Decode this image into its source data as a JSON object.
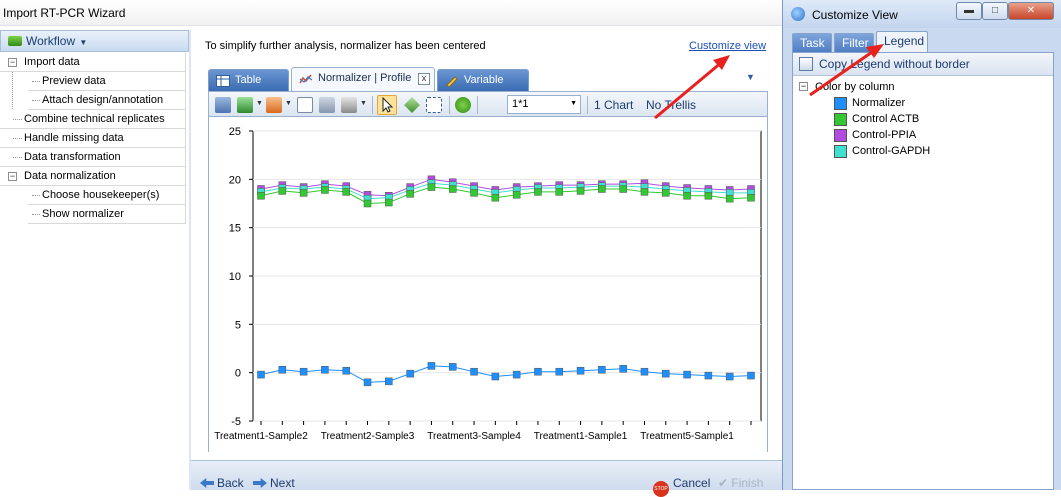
{
  "wizard": {
    "title": "Import RT-PCR Wizard",
    "workflow_label": "Workflow",
    "tree": [
      {
        "label": "Import data",
        "level": 0,
        "expander": "−"
      },
      {
        "label": "Preview data",
        "level": 1
      },
      {
        "label": "Attach design/annotation",
        "level": 1
      },
      {
        "label": "Combine technical replicates",
        "level": 0
      },
      {
        "label": "Handle missing data",
        "level": 0
      },
      {
        "label": "Data transformation",
        "level": 0
      },
      {
        "label": "Data normalization",
        "level": 0,
        "expander": "−"
      },
      {
        "label": "Choose housekeeper(s)",
        "level": 1
      },
      {
        "label": "Show normalizer",
        "level": 1
      }
    ],
    "info_text": "To simplify further analysis, normalizer has been centered",
    "customize_link": "Customize view",
    "tabs": [
      {
        "label": "Table",
        "icon": "table-icon"
      },
      {
        "label": "Normalizer | Profile",
        "icon": "profile-icon",
        "close": "x"
      },
      {
        "label": "Variable",
        "icon": "variable-icon"
      }
    ],
    "toolbar": {
      "zoom_value": "1*1",
      "chart_count": "1 Chart",
      "trellis": "No Trellis"
    },
    "buttons": {
      "back": "Back",
      "next": "Next",
      "cancel": "Cancel",
      "finish": "Finish",
      "stop_icon_text": "STOP"
    }
  },
  "customize_view": {
    "title": "Customize View",
    "win_buttons": {
      "minimize": "▬",
      "maximize": "□",
      "close": "✕"
    },
    "tabs": [
      "Task",
      "Filter",
      "Legend"
    ],
    "active_tab": "Legend",
    "copy_legend": "Copy Legend  without border",
    "legend_root": "Color by column",
    "legend_items": [
      {
        "label": "Normalizer",
        "color": "#1e8fff"
      },
      {
        "label": "Control ACTB",
        "color": "#32c832"
      },
      {
        "label": "Control-PPIA",
        "color": "#b44be1"
      },
      {
        "label": "Control-GAPDH",
        "color": "#40e0d0"
      }
    ]
  },
  "chart_data": {
    "type": "line",
    "ylim": [
      -5,
      25
    ],
    "yticks": [
      25,
      20,
      15,
      10,
      5,
      0,
      -5
    ],
    "x_tick_labels": [
      "Treatment1-Sample2",
      "Treatment2-Sample3",
      "Treatment3-Sample4",
      "Treatment1-Sample1",
      "Treatment5-Sample1"
    ],
    "x_count": 24,
    "series": [
      {
        "color": "#b44be1",
        "values": [
          19.0,
          19.4,
          19.2,
          19.5,
          19.3,
          18.4,
          18.3,
          19.2,
          20.0,
          19.7,
          19.3,
          18.9,
          19.2,
          19.3,
          19.4,
          19.4,
          19.5,
          19.5,
          19.6,
          19.3,
          19.1,
          19.0,
          18.9,
          19.0
        ]
      },
      {
        "color": "#40e0d0",
        "values": [
          18.7,
          19.1,
          19.0,
          19.2,
          19.0,
          18.0,
          18.1,
          18.9,
          19.6,
          19.4,
          19.0,
          18.6,
          18.9,
          19.1,
          19.1,
          19.2,
          19.3,
          19.3,
          19.2,
          19.0,
          18.8,
          18.7,
          18.6,
          18.6
        ]
      },
      {
        "color": "#32c832",
        "values": [
          18.3,
          18.8,
          18.6,
          18.9,
          18.7,
          17.5,
          17.6,
          18.5,
          19.2,
          19.0,
          18.6,
          18.1,
          18.4,
          18.7,
          18.7,
          18.8,
          19.0,
          19.0,
          18.7,
          18.6,
          18.3,
          18.3,
          18.0,
          18.1
        ]
      },
      {
        "color": "#1e8fff",
        "values": [
          -0.2,
          0.3,
          0.1,
          0.3,
          0.2,
          -1.0,
          -0.9,
          -0.1,
          0.7,
          0.6,
          0.1,
          -0.4,
          -0.2,
          0.1,
          0.1,
          0.2,
          0.3,
          0.4,
          0.1,
          -0.1,
          -0.2,
          -0.3,
          -0.4,
          -0.3
        ]
      }
    ]
  }
}
